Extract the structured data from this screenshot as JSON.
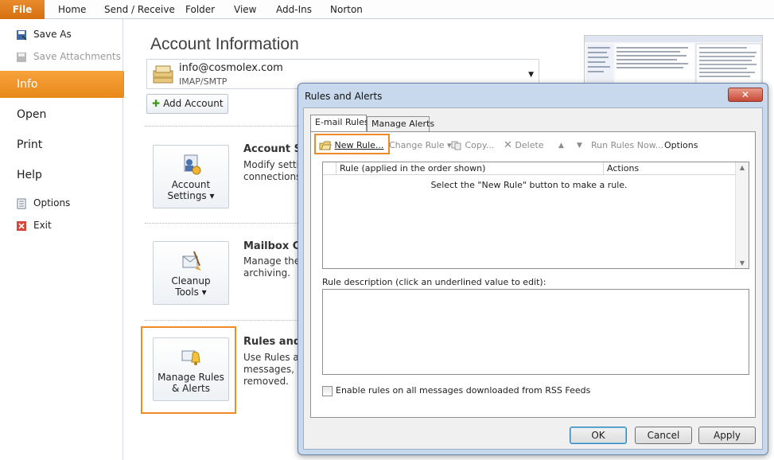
{
  "ribbon": {
    "file": "File",
    "tabs": [
      "Home",
      "Send / Receive",
      "Folder",
      "View",
      "Add-Ins",
      "Norton"
    ]
  },
  "nav": {
    "save_as": "Save As",
    "save_attachments": "Save Attachments",
    "info": "Info",
    "open": "Open",
    "print": "Print",
    "help": "Help",
    "options": "Options",
    "exit": "Exit"
  },
  "main": {
    "title": "Account Information",
    "account_email": "info@cosmolex.com",
    "account_type": "IMAP/SMTP",
    "add_account": "Add Account",
    "account_settings": {
      "button_line1": "Account",
      "button_line2": "Settings ▾",
      "title": "Account Se",
      "text1": "Modify settin",
      "text2": "connections."
    },
    "mailbox_cleanup": {
      "button_line1": "Cleanup",
      "button_line2": "Tools ▾",
      "title": "Mailbox Cl",
      "text1": "Manage the s",
      "text2": "archiving."
    },
    "rules": {
      "button_line1": "Manage Rules",
      "button_line2": "& Alerts",
      "title": "Rules and A",
      "text1": "Use Rules and",
      "text2": "messages, an",
      "text3": "removed."
    }
  },
  "dialog": {
    "title": "Rules and Alerts",
    "close": "✕",
    "tabs": {
      "email_rules": "E-mail Rules",
      "manage_alerts": "Manage Alerts"
    },
    "toolbar": {
      "new_rule": "New Rule...",
      "change_rule": "Change Rule ▾",
      "copy": "Copy...",
      "delete": "Delete",
      "up": "▲",
      "down": "▼",
      "run_rules_now": "Run Rules Now...",
      "options": "Options"
    },
    "list": {
      "col_rule": "Rule (applied in the order shown)",
      "col_actions": "Actions",
      "empty": "Select the \"New Rule\" button to make a rule."
    },
    "description_label": "Rule description (click an underlined value to edit):",
    "rss_label": "Enable rules on all messages downloaded from RSS Feeds",
    "buttons": {
      "ok": "OK",
      "cancel": "Cancel",
      "apply": "Apply"
    }
  },
  "colors": {
    "accent_orange": "#f08a24",
    "file_tab": "#e07a1c",
    "dialog_frame": "#c8d9ed"
  }
}
